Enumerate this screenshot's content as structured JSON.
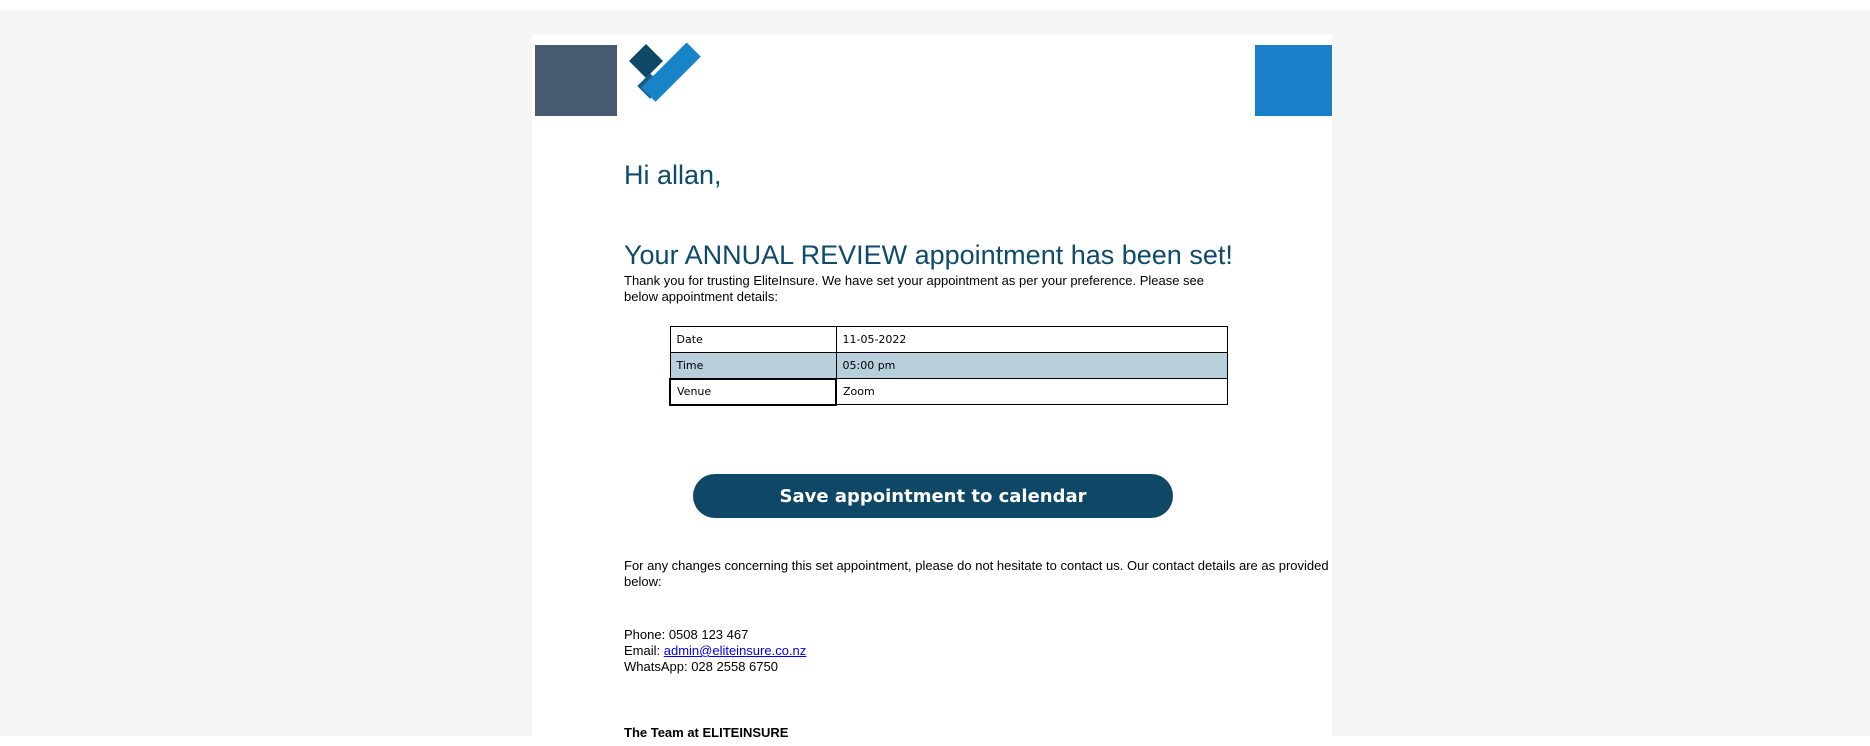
{
  "email": {
    "greeting": "Hi allan,",
    "headline": "Your ANNUAL REVIEW appointment has been set!",
    "intro": "Thank you for trusting EliteInsure. We have set your appointment as per your preference. Please see below appointment details:",
    "details": [
      {
        "label": "Date",
        "value": "11-05-2022"
      },
      {
        "label": "Time",
        "value": "05:00 pm"
      },
      {
        "label": "Venue",
        "value": "Zoom"
      }
    ],
    "cta_label": "Save appointment to calendar",
    "changes_text": "For any changes concerning this set appointment, please do not hesitate to contact us. Our contact details are as provided below:",
    "contact": {
      "phone": "Phone: 0508 123 467",
      "email_prefix": "Email: ",
      "email": "admin@eliteinsure.co.nz",
      "whatsapp": "WhatsApp: 028 2558 6750"
    },
    "signoff": "The Team at ELITEINSURE"
  },
  "colors": {
    "brand_dark": "#0d4a6b",
    "brand_slate": "#475a72",
    "brand_blue": "#1a7fc9",
    "table_shade": "#b8cfdc",
    "button": "#0f4767"
  }
}
